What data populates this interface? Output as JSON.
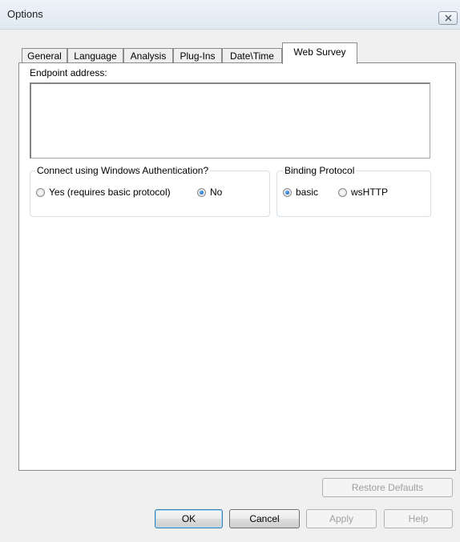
{
  "window": {
    "title": "Options"
  },
  "tabs": [
    {
      "label": "General"
    },
    {
      "label": "Language"
    },
    {
      "label": "Analysis"
    },
    {
      "label": "Plug-Ins"
    },
    {
      "label": "Date\\Time"
    },
    {
      "label": "Web Survey",
      "active": true
    }
  ],
  "web_survey": {
    "endpoint_label": "Endpoint address:",
    "endpoint_value": "",
    "auth_group": {
      "legend": "Connect using Windows Authentication?",
      "options": [
        {
          "label": "Yes (requires basic protocol)",
          "checked": false
        },
        {
          "label": "No",
          "checked": true
        }
      ]
    },
    "binding_group": {
      "legend": "Binding Protocol",
      "options": [
        {
          "label": "basic",
          "checked": true
        },
        {
          "label": "wsHTTP",
          "checked": false
        }
      ]
    }
  },
  "buttons": {
    "restore_defaults": "Restore Defaults",
    "ok": "OK",
    "cancel": "Cancel",
    "apply": "Apply",
    "help": "Help"
  }
}
